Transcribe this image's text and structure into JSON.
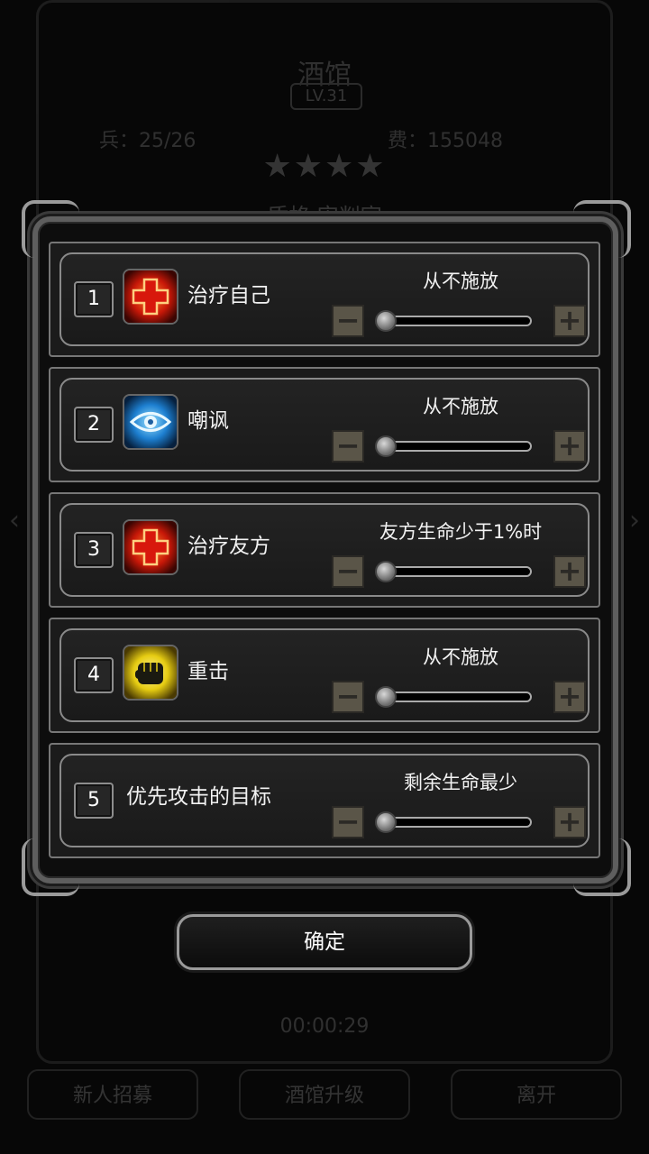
{
  "background": {
    "hero_name": "酒馆",
    "level": "LV.31",
    "stat_left": "兵：25/26",
    "stat_right": "费：155048",
    "stars": "★★★★",
    "hero_class": "盾格 审判官",
    "timer": "00:00:29",
    "buttons": [
      "新人招募",
      "酒馆升级",
      "离开"
    ]
  },
  "skills": [
    {
      "index": "1",
      "name": "治疗自己",
      "icon": "heal-cross-icon",
      "condition": "从不施放",
      "level": 0
    },
    {
      "index": "2",
      "name": "嘲讽",
      "icon": "taunt-eye-icon",
      "condition": "从不施放",
      "level": 0
    },
    {
      "index": "3",
      "name": "治疗友方",
      "icon": "heal-cross-icon",
      "condition": "友方生命少于1%时",
      "level": 0
    },
    {
      "index": "4",
      "name": "重击",
      "icon": "fist-icon",
      "condition": "从不施放",
      "level": 0
    },
    {
      "index": "5",
      "name": "优先攻击的目标",
      "icon": "",
      "condition": "剩余生命最少",
      "level": 0
    }
  ],
  "controls": {
    "minus": "−",
    "plus": "+"
  },
  "confirm_label": "确定",
  "colors": {
    "heal": "#e0281c",
    "taunt": "#2a8fd8",
    "fist": "#e8d21a"
  }
}
